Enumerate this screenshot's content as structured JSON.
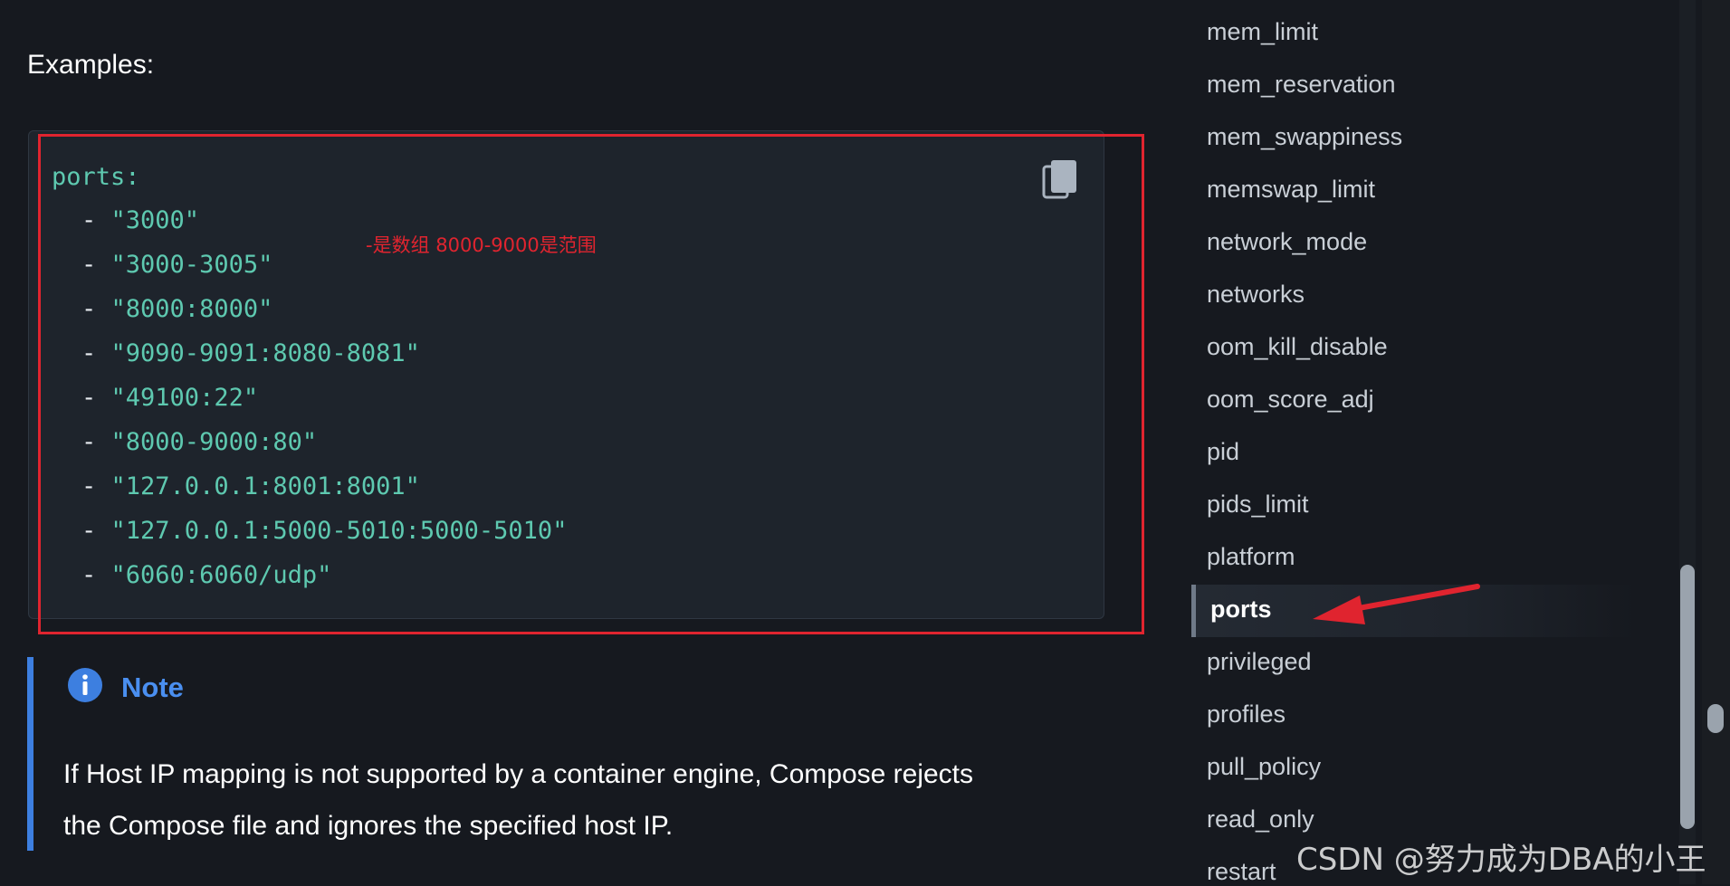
{
  "main": {
    "examples_label": "Examples:",
    "code": {
      "key": "ports:",
      "items": [
        "\"3000\"",
        "\"3000-3005\"",
        "\"8000:8000\"",
        "\"9090-9091:8080-8081\"",
        "\"49100:22\"",
        "\"8000-9000:80\"",
        "\"127.0.0.1:8001:8001\"",
        "\"127.0.0.1:5000-5010:5000-5010\"",
        "\"6060:6060/udp\""
      ],
      "dash": "-"
    },
    "annotation": "-是数组 8000-9000是范围",
    "note": {
      "title": "Note",
      "line1": "If Host IP mapping is not supported by a container engine, Compose rejects",
      "line2": "the Compose file and ignores the specified host IP."
    }
  },
  "sidebar": {
    "items": [
      "mem_limit",
      "mem_reservation",
      "mem_swappiness",
      "memswap_limit",
      "network_mode",
      "networks",
      "oom_kill_disable",
      "oom_score_adj",
      "pid",
      "pids_limit",
      "platform",
      "ports",
      "privileged",
      "profiles",
      "pull_policy",
      "read_only",
      "restart"
    ],
    "active_item": "ports"
  },
  "watermark": "CSDN @努力成为DBA的小王",
  "colors": {
    "background": "#16191f",
    "code_background": "#1e242c",
    "code_string": "#5ec9b0",
    "highlight_red": "#e0242f",
    "note_accent": "#3d7fe0",
    "note_title": "#4a8ff0"
  },
  "icons": {
    "copy": "copy-icon",
    "note": "info-icon",
    "arrow": "arrow-annotation"
  }
}
